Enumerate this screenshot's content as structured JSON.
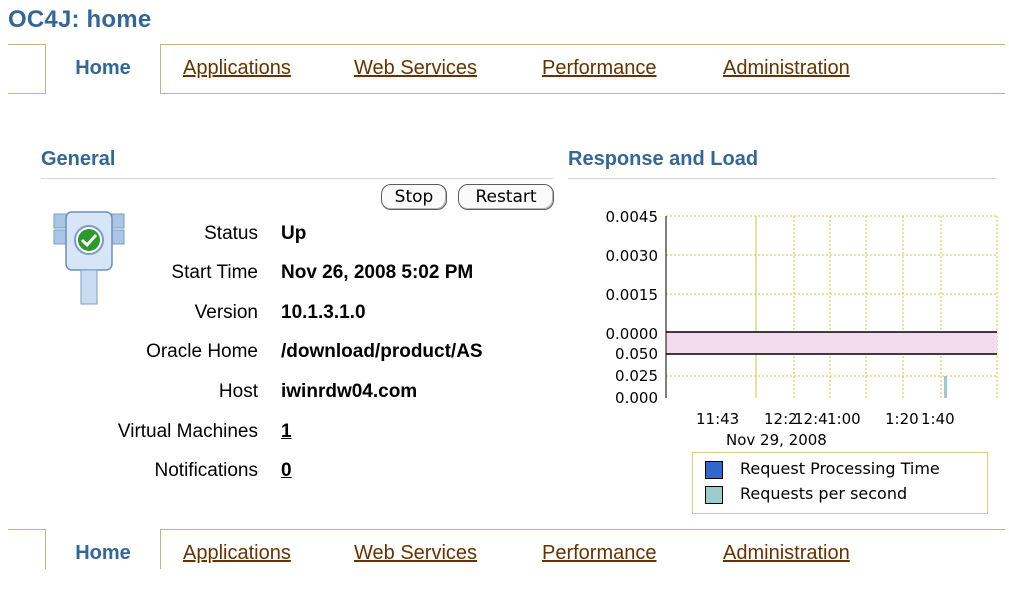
{
  "page": {
    "title": "OC4J: home"
  },
  "tabs": [
    {
      "label": "Home",
      "selected": true
    },
    {
      "label": "Applications",
      "selected": false
    },
    {
      "label": "Web Services",
      "selected": false
    },
    {
      "label": "Performance",
      "selected": false
    },
    {
      "label": "Administration",
      "selected": false
    }
  ],
  "general": {
    "title": "General",
    "buttons": {
      "stop": "Stop",
      "restart": "Restart"
    },
    "status_icon": "traffic-light-up-icon",
    "fields": {
      "status": {
        "label": "Status",
        "value": "Up"
      },
      "start_time": {
        "label": "Start Time",
        "value": "Nov 26, 2008 5:02 PM"
      },
      "version": {
        "label": "Version",
        "value": "10.1.3.1.0"
      },
      "oracle_home": {
        "label": "Oracle Home",
        "value": "/download/product/AS"
      },
      "host": {
        "label": "Host",
        "value": "iwinrdw04.com"
      },
      "virtual_machines": {
        "label": "Virtual Machines",
        "value": "1"
      },
      "notifications": {
        "label": "Notifications",
        "value": "0"
      }
    }
  },
  "response": {
    "title": "Response and Load"
  },
  "chart_data": {
    "type": "line",
    "x_ticks": [
      "11:43",
      "12:2",
      "12:4",
      "1:00",
      "1:20",
      "1:40"
    ],
    "x_date": "Nov 29, 2008",
    "upper": {
      "series_name": "Request Processing Time",
      "y_ticks": [
        "0.0045",
        "0.0030",
        "0.0015",
        "0.0000"
      ],
      "ylim": [
        0,
        0.0045
      ]
    },
    "lower": {
      "series_name": "Requests per second",
      "y_ticks": [
        "0.050",
        "0.025",
        "0.000"
      ],
      "ylim": [
        0,
        0.05
      ],
      "spike_at": "1:40",
      "spike_value": 0.025
    },
    "legend": [
      {
        "label": "Request Processing Time",
        "color": "#3366cc"
      },
      {
        "label": "Requests per second",
        "color": "#99cccc"
      }
    ],
    "grid": true,
    "colors": {
      "grid": "#c8c840",
      "band": "#f3dbee"
    }
  }
}
